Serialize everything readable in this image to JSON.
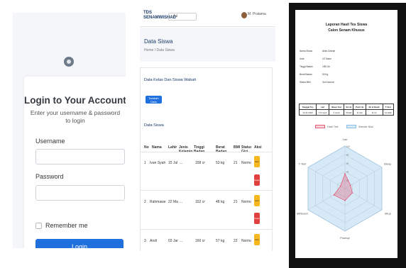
{
  "login": {
    "title": "Login to Your Account",
    "subtitle": "Enter your username & password to login",
    "username_label": "Username",
    "username_value": "",
    "password_label": "Password",
    "password_value": "",
    "remember_label": "Remember me",
    "login_button": "Login",
    "accent": "#1f6fdc"
  },
  "list_page": {
    "brand": "TDS SENAMWISHAD",
    "select_value": "Jul",
    "user_name": "M. Pratama",
    "page_title": "Data Siswa",
    "breadcrumb": "Home / Data Siswa",
    "section_add": "Data Kelas Dan Siswa Wabah",
    "add_button": "Tambah Data",
    "section_table": "Data Siswa",
    "columns": [
      "No",
      "Nama",
      "Lahir",
      "Jenis Kelamin",
      "Tinggi Badan",
      "Berat Badan",
      "BMI",
      "Status Gizi",
      "Aksi"
    ],
    "rows": [
      [
        "1",
        "Ivan Syahid",
        "15 Jul ...",
        "...",
        "158 cm",
        "53 kg",
        "21",
        "Normal"
      ],
      [
        "2",
        "Rahmawati",
        "22 Mar ...",
        "...",
        "152 cm",
        "48 kg",
        "21",
        "Normal"
      ],
      [
        "3",
        "Andi",
        "03 Jan ...",
        "...",
        "160 cm",
        "57 kg",
        "22",
        "Normal"
      ]
    ],
    "edit_label": "Edit",
    "delete_label": "Hapus",
    "edit_color": "#f6b81e",
    "delete_color": "#e0413e"
  },
  "report": {
    "title_line1": "Laporan Hasil Tes Siswa",
    "title_line2": "Calon Senam Khusus",
    "info": [
      {
        "k": "Nama Siswa",
        "v": "Akira Zahrah"
      },
      {
        "k": "Usia",
        "v": "15 Tahun"
      },
      {
        "k": "Tinggi Badan",
        "v": "158 Cm"
      },
      {
        "k": "Berat Badan",
        "v": "53 Kg"
      },
      {
        "k": "Status BMI",
        "v": "Gizi Normal"
      }
    ],
    "table_headers": [
      "Tanggal Tes",
      "Lari",
      "Bleep Test",
      "Sit Up",
      "Push Up",
      "Sit & Reach",
      "T-Test"
    ],
    "table_row": [
      "24-11-2023",
      "1.5 menit",
      "6 menit",
      "30 kali",
      "11 kali",
      "11 cm",
      "13 detik"
    ],
    "legend": [
      "Hasil Test",
      "Standar Nilai"
    ],
    "axis_labels": [
      "Lari",
      "Bleep",
      "Situp",
      "Pushup",
      "SitReach",
      "T-Test"
    ],
    "tick_labels": [
      "100",
      "80",
      "60",
      "40",
      "20"
    ]
  },
  "chart_data": {
    "type": "radar",
    "categories": [
      "Lari",
      "Bleep",
      "Situp",
      "Pushup",
      "SitReach",
      "T-Test"
    ],
    "series": [
      {
        "name": "Hasil Test",
        "values": [
          35,
          15,
          20,
          28,
          30,
          12
        ],
        "color": "#e2627a"
      },
      {
        "name": "Standar Nilai",
        "values": [
          100,
          100,
          100,
          100,
          100,
          100
        ],
        "color": "#8fc1e6"
      }
    ],
    "title": "",
    "xlabel": "",
    "ylabel": "",
    "ylim": [
      0,
      100
    ],
    "legend": "top",
    "grid": true
  }
}
